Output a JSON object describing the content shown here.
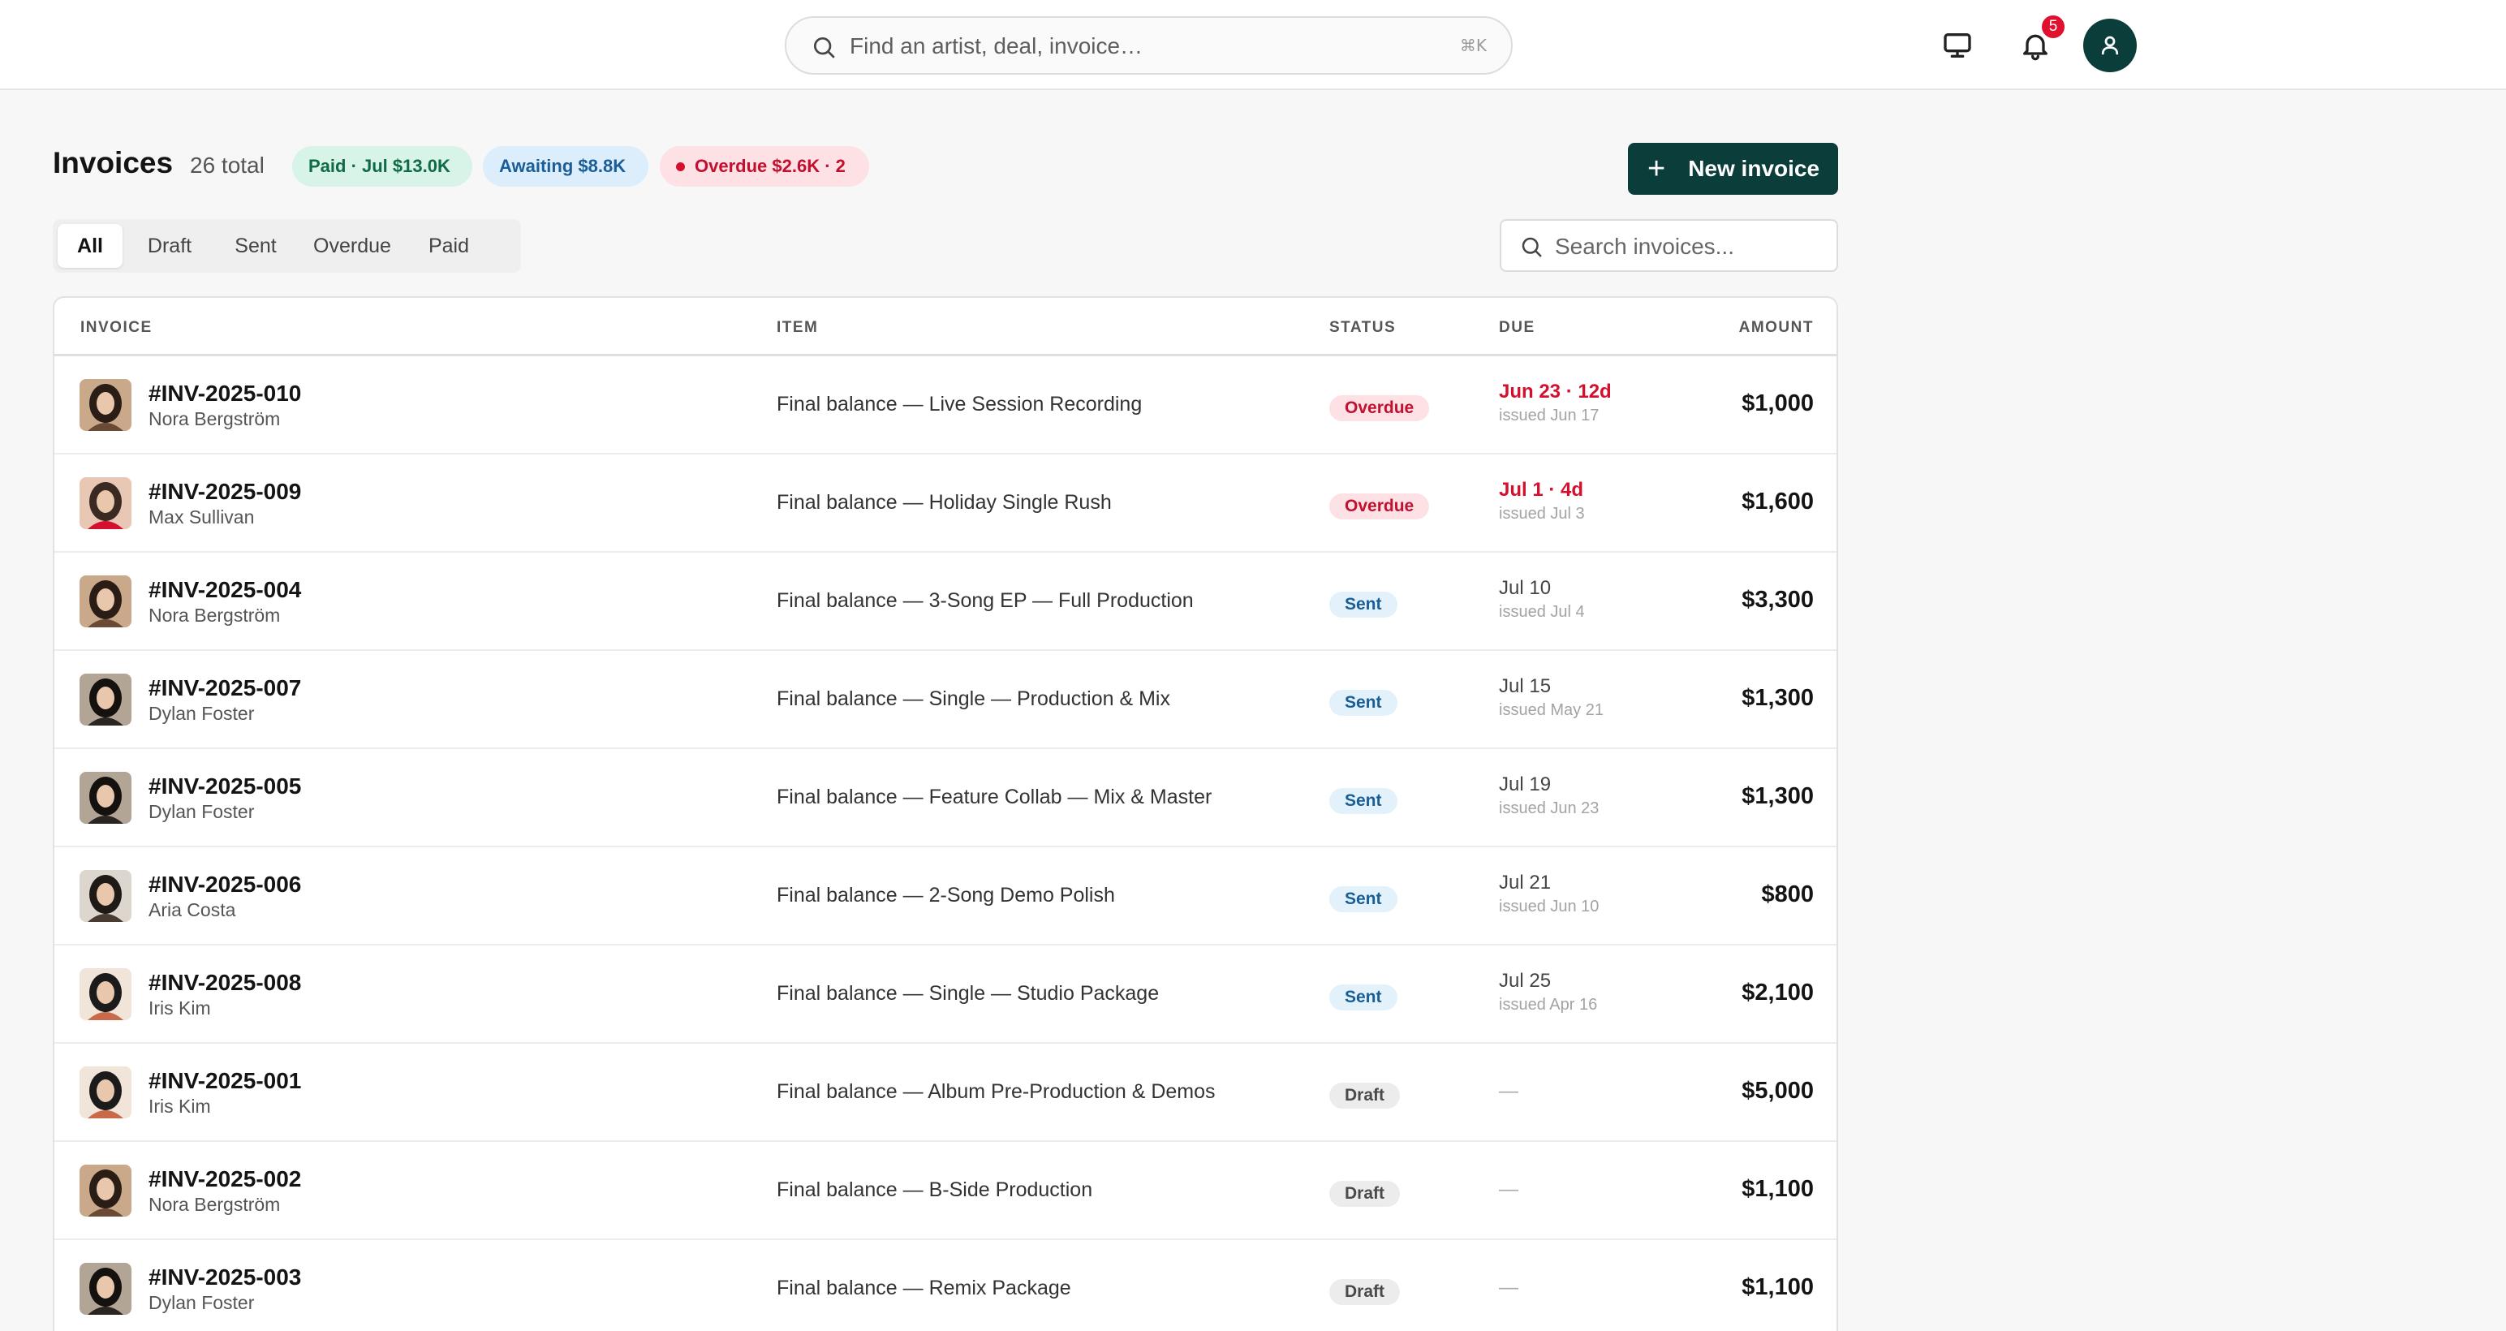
{
  "search": {
    "placeholder": "Find an artist, deal, invoice…",
    "shortcut": "⌘K"
  },
  "notifications": {
    "count": "5"
  },
  "header": {
    "title": "Invoices",
    "total": "26 total",
    "pills": {
      "paid": "Paid · Jul $13.0K",
      "awaiting": "Awaiting $8.8K",
      "overdue": "Overdue $2.6K · 2"
    },
    "new_button": "New invoice"
  },
  "tabs": [
    "All",
    "Draft",
    "Sent",
    "Overdue",
    "Paid"
  ],
  "active_tab": "All",
  "table_search": {
    "placeholder": "Search invoices..."
  },
  "table": {
    "columns": {
      "invoice": "INVOICE",
      "item": "ITEM",
      "status": "STATUS",
      "due": "DUE",
      "amount": "AMOUNT"
    },
    "rows": [
      {
        "id": "#INV-2025-010",
        "client": "Nora Bergström",
        "item": "Final balance — Live Session Recording",
        "status": "Overdue",
        "due": "Jun 23 · 12d",
        "issued": "issued Jun 17",
        "amount": "$1,000"
      },
      {
        "id": "#INV-2025-009",
        "client": "Max Sullivan",
        "item": "Final balance — Holiday Single Rush",
        "status": "Overdue",
        "due": "Jul 1 · 4d",
        "issued": "issued Jul 3",
        "amount": "$1,600"
      },
      {
        "id": "#INV-2025-004",
        "client": "Nora Bergström",
        "item": "Final balance — 3-Song EP — Full Production",
        "status": "Sent",
        "due": "Jul 10",
        "issued": "issued Jul 4",
        "amount": "$3,300"
      },
      {
        "id": "#INV-2025-007",
        "client": "Dylan Foster",
        "item": "Final balance — Single — Production & Mix",
        "status": "Sent",
        "due": "Jul 15",
        "issued": "issued May 21",
        "amount": "$1,300"
      },
      {
        "id": "#INV-2025-005",
        "client": "Dylan Foster",
        "item": "Final balance — Feature Collab — Mix & Master",
        "status": "Sent",
        "due": "Jul 19",
        "issued": "issued Jun 23",
        "amount": "$1,300"
      },
      {
        "id": "#INV-2025-006",
        "client": "Aria Costa",
        "item": "Final balance — 2-Song Demo Polish",
        "status": "Sent",
        "due": "Jul 21",
        "issued": "issued Jun 10",
        "amount": "$800"
      },
      {
        "id": "#INV-2025-008",
        "client": "Iris Kim",
        "item": "Final balance — Single — Studio Package",
        "status": "Sent",
        "due": "Jul 25",
        "issued": "issued Apr 16",
        "amount": "$2,100"
      },
      {
        "id": "#INV-2025-001",
        "client": "Iris Kim",
        "item": "Final balance — Album Pre-Production & Demos",
        "status": "Draft",
        "due": "—",
        "issued": "",
        "amount": "$5,000"
      },
      {
        "id": "#INV-2025-002",
        "client": "Nora Bergström",
        "item": "Final balance — B-Side Production",
        "status": "Draft",
        "due": "—",
        "issued": "",
        "amount": "$1,100"
      },
      {
        "id": "#INV-2025-003",
        "client": "Dylan Foster",
        "item": "Final balance — Remix Package",
        "status": "Draft",
        "due": "—",
        "issued": "",
        "amount": "$1,100"
      }
    ]
  },
  "colors": {
    "brand": "#0b3d3b",
    "overdue": "#d4102e",
    "sent": "#1a5e96",
    "paid": "#0f6b45"
  }
}
